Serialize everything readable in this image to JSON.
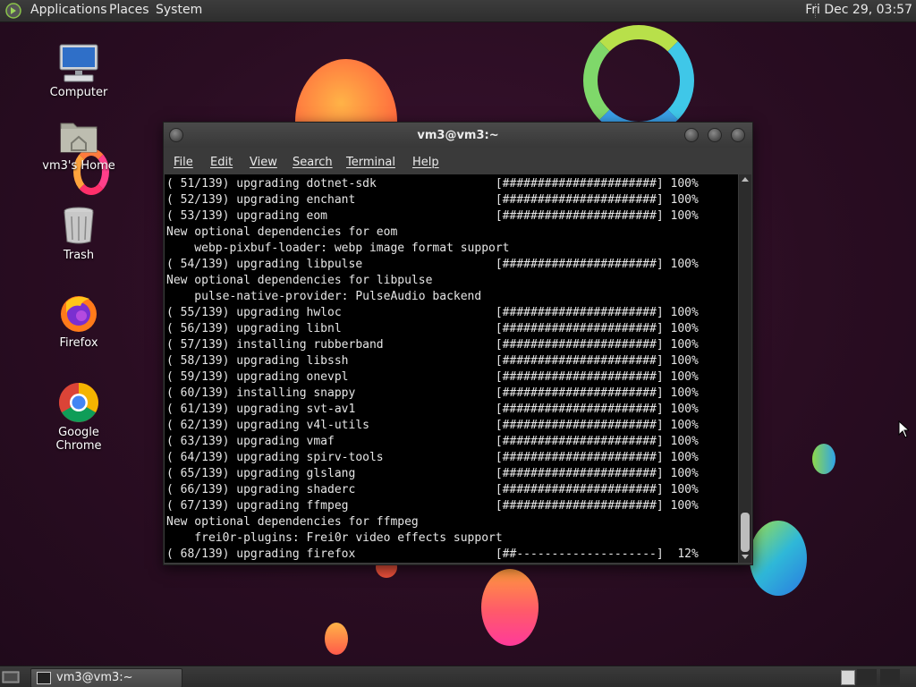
{
  "top_panel": {
    "menus": [
      "Applications",
      "Places",
      "System"
    ],
    "clock": "Fri Dec 29, 03:57"
  },
  "desktop_icons": [
    {
      "label": "Computer",
      "icon": "computer-icon"
    },
    {
      "label": "vm3's Home",
      "icon": "home-folder-icon"
    },
    {
      "label": "Trash",
      "icon": "trash-icon"
    },
    {
      "label": "Firefox",
      "icon": "firefox-icon"
    },
    {
      "label": "Google Chrome",
      "icon": "chrome-icon"
    }
  ],
  "terminal": {
    "title": "vm3@vm3:~",
    "menu": [
      "File",
      "Edit",
      "View",
      "Search",
      "Terminal",
      "Help"
    ],
    "lines": [
      "( 51/139) upgrading dotnet-sdk                 [######################] 100%",
      "( 52/139) upgrading enchant                    [######################] 100%",
      "( 53/139) upgrading eom                        [######################] 100%",
      "New optional dependencies for eom",
      "    webp-pixbuf-loader: webp image format support",
      "( 54/139) upgrading libpulse                   [######################] 100%",
      "New optional dependencies for libpulse",
      "    pulse-native-provider: PulseAudio backend",
      "( 55/139) upgrading hwloc                      [######################] 100%",
      "( 56/139) upgrading libnl                      [######################] 100%",
      "( 57/139) installing rubberband                [######################] 100%",
      "( 58/139) upgrading libssh                     [######################] 100%",
      "( 59/139) upgrading onevpl                     [######################] 100%",
      "( 60/139) installing snappy                    [######################] 100%",
      "( 61/139) upgrading svt-av1                    [######################] 100%",
      "( 62/139) upgrading v4l-utils                  [######################] 100%",
      "( 63/139) upgrading vmaf                       [######################] 100%",
      "( 64/139) upgrading spirv-tools                [######################] 100%",
      "( 65/139) upgrading glslang                    [######################] 100%",
      "( 66/139) upgrading shaderc                    [######################] 100%",
      "( 67/139) upgrading ffmpeg                     [######################] 100%",
      "New optional dependencies for ffmpeg",
      "    frei0r-plugins: Frei0r video effects support",
      "( 68/139) upgrading firefox                    [##--------------------]  12%"
    ]
  },
  "taskbar": {
    "window_button": "vm3@vm3:~"
  },
  "colors": {
    "desktop_bg": "#2a0d22",
    "terminal_bg": "#000000",
    "terminal_fg": "#e6e6e6",
    "panel_bg": "#333333"
  }
}
